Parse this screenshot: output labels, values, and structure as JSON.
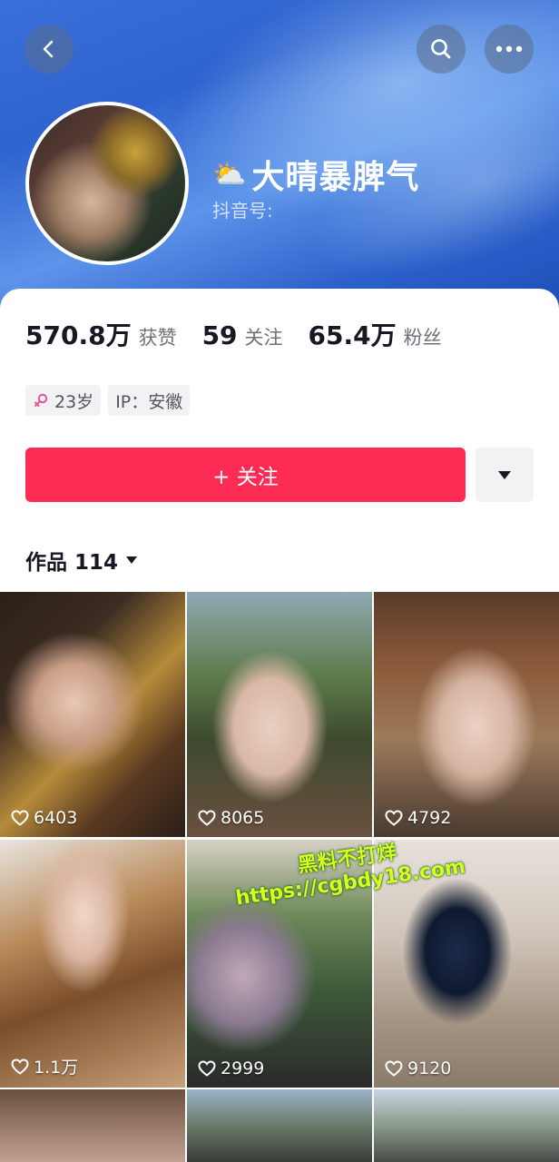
{
  "profile": {
    "name": "大晴暴脾气",
    "name_emoji": "⛅",
    "douyin_id_label": "抖音号:",
    "stats": [
      {
        "value": "570.8万",
        "label": "获赞"
      },
      {
        "value": "59",
        "label": "关注"
      },
      {
        "value": "65.4万",
        "label": "粉丝"
      }
    ],
    "tags": [
      {
        "icon": "female-icon",
        "text": "23岁"
      },
      {
        "text": "IP：安徽"
      }
    ],
    "follow_label": "+ 关注"
  },
  "works": {
    "tab_label": "作品 114",
    "items": [
      {
        "likes": "6403"
      },
      {
        "likes": "8065"
      },
      {
        "likes": "4792"
      },
      {
        "likes": "1.1万"
      },
      {
        "likes": "2999"
      },
      {
        "likes": "9120"
      }
    ]
  },
  "watermark": {
    "line1": "黑料不打烊",
    "line2": "https://cgbdy18.com"
  },
  "colors": {
    "accent": "#fe2c55",
    "header_blue": "#3a6fd8",
    "watermark": "#d6ff1e"
  }
}
